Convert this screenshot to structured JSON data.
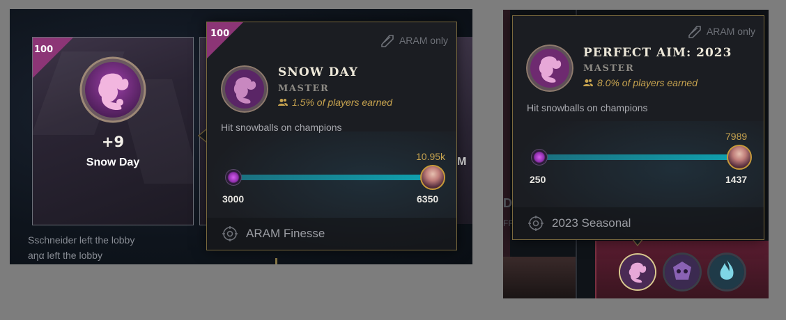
{
  "left": {
    "card": {
      "level_badge": "100",
      "count": "+9",
      "name": "Snow Day"
    },
    "partial_card_letter": "M",
    "chat": [
      "Sschneider left the lobby",
      "aηα left the lobby"
    ],
    "tooltip": {
      "level_badge": "100",
      "mode_tag": "ARAM only",
      "title": "SNOW DAY",
      "tier": "MASTER",
      "earned": "1.5% of players earned",
      "description": "Hit snowballs on champions",
      "progress": {
        "start": "3000",
        "current": "6350",
        "next": "10.95k",
        "fill_fraction": 1.0
      },
      "category": "ARAM Finesse"
    }
  },
  "right": {
    "tooltip": {
      "mode_tag": "ARAM only",
      "title": "PERFECT AIM: 2023",
      "tier": "MASTER",
      "earned": "8.0% of players earned",
      "description": "Hit snowballs on champions",
      "progress": {
        "start": "250",
        "current": "1437",
        "next": "7989",
        "fill_fraction": 1.0
      },
      "category": "2023 Seasonal"
    },
    "side_text": [
      "DI",
      "FF"
    ],
    "bottom_icons": [
      "snowball-emblem-icon",
      "aram-skull-emblem-icon",
      "frost-flame-emblem-icon"
    ]
  },
  "colors": {
    "gold": "#c7a34f",
    "border": "#7b6a3e",
    "badge": "#8c3576",
    "track": "#0fa2b0"
  }
}
